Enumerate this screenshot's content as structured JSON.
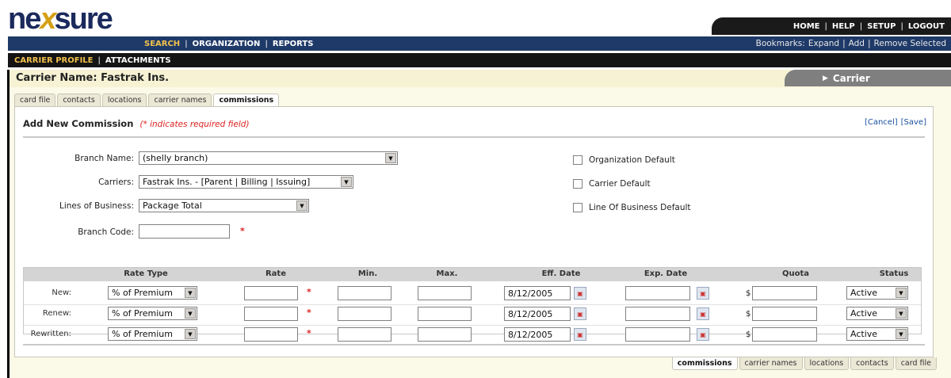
{
  "logo": {
    "part1": "ne",
    "part2": "x",
    "part3": "sure"
  },
  "utility_nav": [
    "HOME",
    "HELP",
    "SETUP",
    "LOGOUT"
  ],
  "main_nav": {
    "items": [
      "SEARCH",
      "ORGANIZATION",
      "REPORTS"
    ],
    "active": "SEARCH"
  },
  "bookmarks": {
    "label": "Bookmarks:",
    "items": [
      "Expand",
      "Add",
      "Remove Selected"
    ]
  },
  "sub_nav": {
    "items": [
      "CARRIER PROFILE",
      "ATTACHMENTS"
    ],
    "active": "CARRIER PROFILE"
  },
  "page_title": "Carrier Name: Fastrak Ins.",
  "context_tab": "Carrier",
  "tabs": [
    "card file",
    "contacts",
    "locations",
    "carrier names",
    "commissions"
  ],
  "active_tab": "commissions",
  "bottom_tabs": [
    "commissions",
    "carrier names",
    "locations",
    "contacts",
    "card file"
  ],
  "panel": {
    "title": "Add New Commission",
    "required_note": "(* indicates required field)",
    "cancel": "[Cancel]",
    "save": "[Save]"
  },
  "form": {
    "branch_name": {
      "label": "Branch Name:",
      "value": "(shelly branch)"
    },
    "carriers": {
      "label": "Carriers:",
      "value": "Fastrak Ins. - [Parent | Billing | Issuing]"
    },
    "lines_of_business": {
      "label": "Lines of Business:",
      "value": "Package Total"
    },
    "branch_code": {
      "label": "Branch Code:",
      "value": "",
      "required_mark": "*"
    }
  },
  "checkboxes": [
    {
      "label": "Organization Default",
      "checked": false
    },
    {
      "label": "Carrier Default",
      "checked": false
    },
    {
      "label": "Line Of Business Default",
      "checked": false
    }
  ],
  "grid": {
    "columns": [
      "Rate Type",
      "Rate",
      "Min.",
      "Max.",
      "Eff. Date",
      "Exp. Date",
      "Quota",
      "Status"
    ],
    "rows": [
      {
        "label": "New:",
        "rate_type": "% of Premium",
        "rate": "",
        "min": "",
        "max": "",
        "eff_date": "8/12/2005",
        "exp_date": "",
        "quota": "",
        "status": "Active"
      },
      {
        "label": "Renew:",
        "rate_type": "% of Premium",
        "rate": "",
        "min": "",
        "max": "",
        "eff_date": "8/12/2005",
        "exp_date": "",
        "quota": "",
        "status": "Active"
      },
      {
        "label": "Rewritten:",
        "rate_type": "% of Premium",
        "rate": "",
        "min": "",
        "max": "",
        "eff_date": "8/12/2005",
        "exp_date": "",
        "quota": "",
        "status": "Active"
      }
    ],
    "required_mark": "*",
    "currency_symbol": "$"
  },
  "icons": {
    "calendar": "calendar-icon",
    "dropdown": "chevron-down-icon",
    "context": "triangle-right-icon"
  },
  "colors": {
    "nav_blue": "#1f3a68",
    "accent_gold": "#f2c14e",
    "band": "#f6f2d3",
    "required_red": "#dd2222",
    "link_blue": "#1a4fa0"
  }
}
